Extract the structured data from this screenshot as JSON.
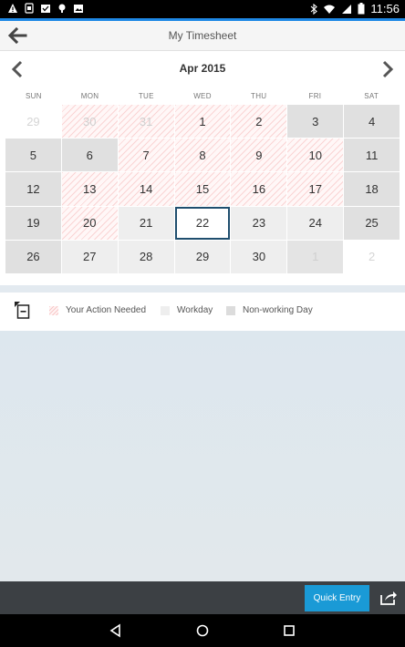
{
  "status_bar": {
    "time": "11:56",
    "left_icons": [
      "warning-icon",
      "sim-card-icon",
      "task-check-icon",
      "android-icon",
      "photo-icon"
    ],
    "right_icons": [
      "bluetooth-icon",
      "wifi-icon",
      "signal-icon",
      "battery-icon"
    ]
  },
  "header": {
    "title": "My Timesheet"
  },
  "calendar": {
    "month_label": "Apr 2015",
    "weekdays": [
      "SUN",
      "MON",
      "TUE",
      "WED",
      "THU",
      "FRI",
      "SAT"
    ],
    "weeks": [
      [
        {
          "day": "29",
          "type": "other-light"
        },
        {
          "day": "30",
          "type": "other-action"
        },
        {
          "day": "31",
          "type": "other-action"
        },
        {
          "day": "1",
          "type": "action"
        },
        {
          "day": "2",
          "type": "action"
        },
        {
          "day": "3",
          "type": "nonwork"
        },
        {
          "day": "4",
          "type": "nonwork"
        }
      ],
      [
        {
          "day": "5",
          "type": "nonwork"
        },
        {
          "day": "6",
          "type": "nonwork"
        },
        {
          "day": "7",
          "type": "action"
        },
        {
          "day": "8",
          "type": "action"
        },
        {
          "day": "9",
          "type": "action"
        },
        {
          "day": "10",
          "type": "action"
        },
        {
          "day": "11",
          "type": "nonwork"
        }
      ],
      [
        {
          "day": "12",
          "type": "nonwork"
        },
        {
          "day": "13",
          "type": "action"
        },
        {
          "day": "14",
          "type": "action"
        },
        {
          "day": "15",
          "type": "action"
        },
        {
          "day": "16",
          "type": "action"
        },
        {
          "day": "17",
          "type": "action"
        },
        {
          "day": "18",
          "type": "nonwork"
        }
      ],
      [
        {
          "day": "19",
          "type": "nonwork"
        },
        {
          "day": "20",
          "type": "action"
        },
        {
          "day": "21",
          "type": "workday"
        },
        {
          "day": "22",
          "type": "today"
        },
        {
          "day": "23",
          "type": "workday"
        },
        {
          "day": "24",
          "type": "workday"
        },
        {
          "day": "25",
          "type": "nonwork"
        }
      ],
      [
        {
          "day": "26",
          "type": "nonwork"
        },
        {
          "day": "27",
          "type": "workday"
        },
        {
          "day": "28",
          "type": "workday"
        },
        {
          "day": "29",
          "type": "workday"
        },
        {
          "day": "30",
          "type": "workday"
        },
        {
          "day": "1",
          "type": "other-nonwork"
        },
        {
          "day": "2",
          "type": "other-light"
        }
      ]
    ]
  },
  "legend": {
    "action_needed": "Your Action Needed",
    "workday": "Workday",
    "non_working": "Non-working Day"
  },
  "toolbar": {
    "quick_entry": "Quick Entry"
  },
  "colors": {
    "accent": "#1e88e5",
    "quick_entry_bg": "#1a9ad6",
    "toolbar_bg": "#3c4044",
    "today_border": "#1f4e6e"
  }
}
